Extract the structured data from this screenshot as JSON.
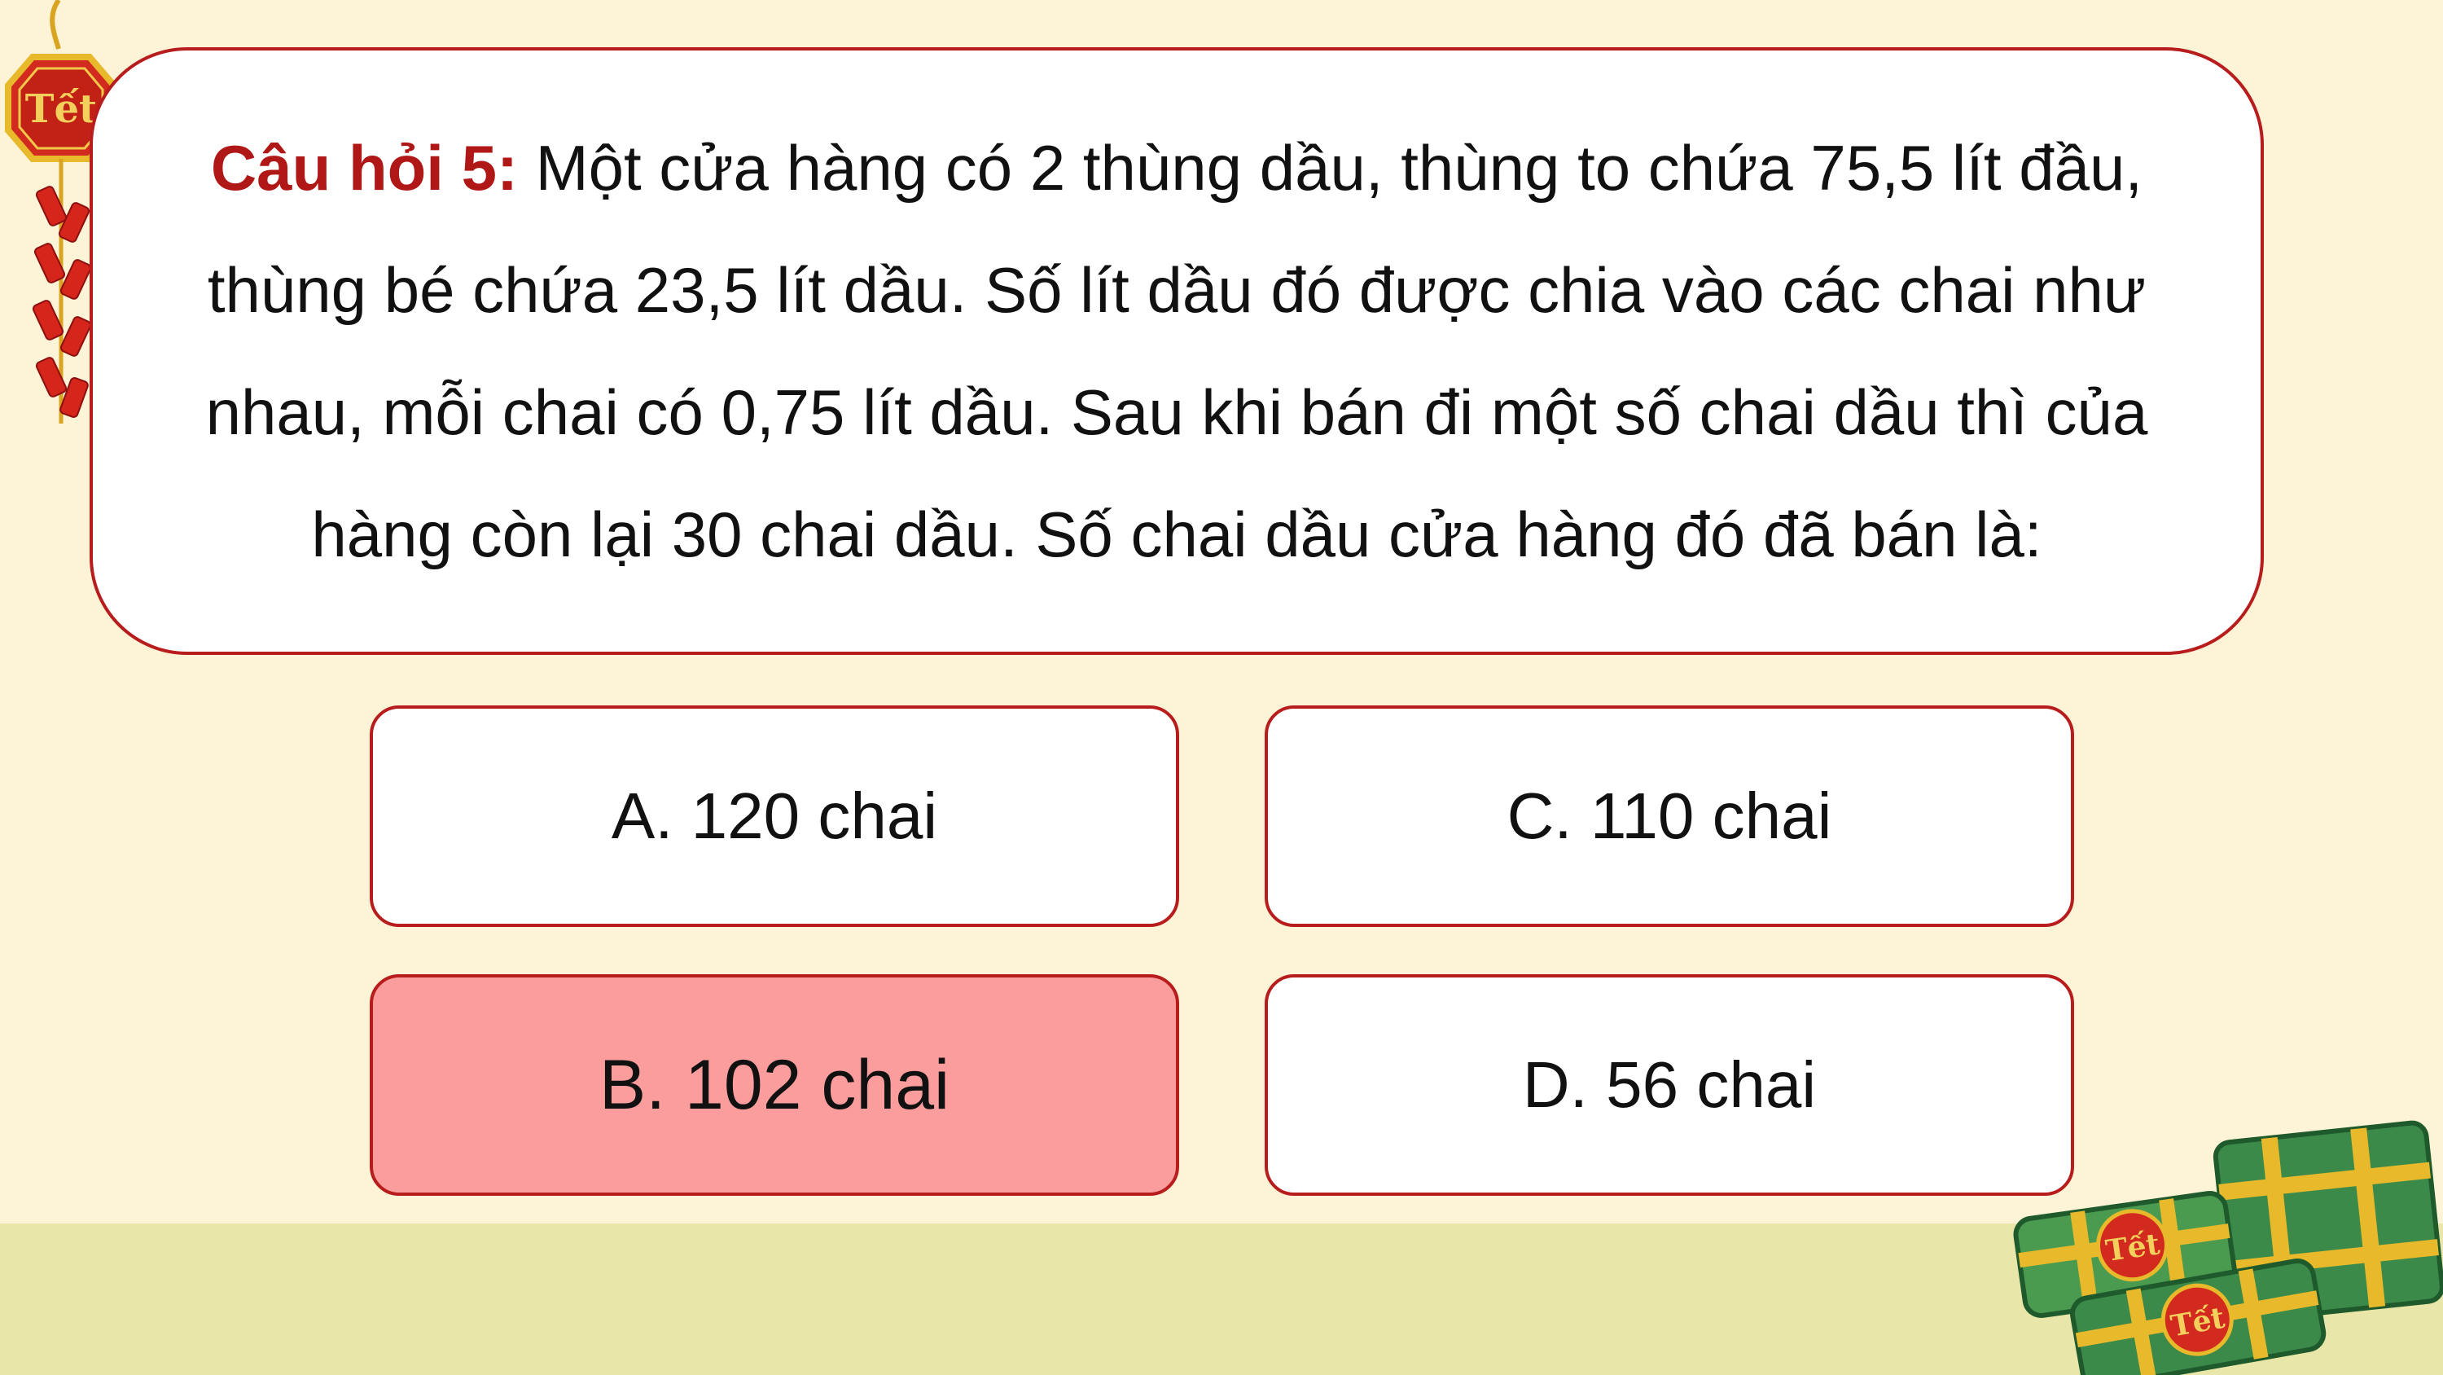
{
  "question": {
    "label": "Câu hỏi 5:",
    "text": " Một cửa hàng có 2 thùng dầu, thùng to chứa 75,5 lít đầu, thùng bé chứa 23,5 lít dầu. Số lít dầu đó được chia vào các chai như nhau, mỗi chai có 0,75 lít dầu. Sau khi bán đi một số chai dầu thì của hàng còn lại 30 chai dầu. Số chai dầu cửa hàng đó đã bán là:"
  },
  "answers": {
    "a": "A. 120 chai",
    "b": "B. 102 chai",
    "c": "C. 110 chai",
    "d": "D. 56 chai"
  },
  "selected_answer": "b",
  "decorations": {
    "firecracker_tag": "Tết",
    "banh_chung_tag_1": "Tết",
    "banh_chung_tag_2": "Tết"
  },
  "colors": {
    "background": "#fdf3d6",
    "ground": "#e8e6a8",
    "accent_red": "#b81d1d",
    "selected_fill": "#fc9d9d",
    "cake_green": "#3c8a4a",
    "cake_ribbon": "#e8b92a"
  }
}
